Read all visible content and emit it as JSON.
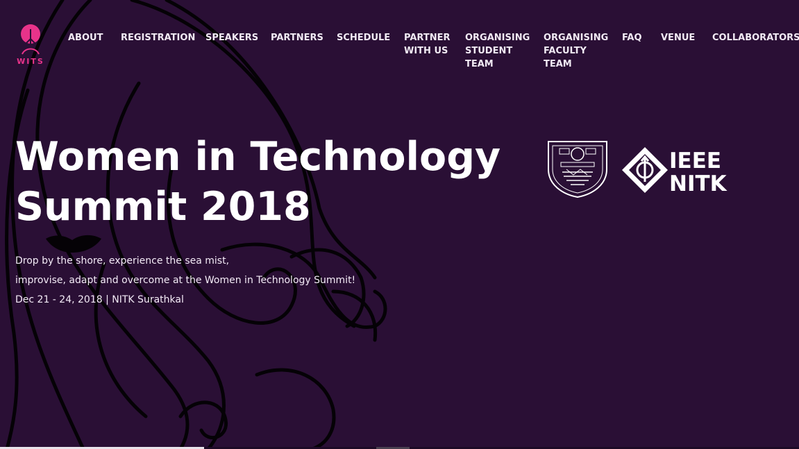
{
  "brand": {
    "logo_text": "WITS",
    "accent_color": "#e8338a",
    "background_color": "#2a0f35"
  },
  "nav": {
    "items": [
      {
        "label": "ABOUT"
      },
      {
        "label": "REGISTRATION"
      },
      {
        "label": "SPEAKERS"
      },
      {
        "label": "PARTNERS"
      },
      {
        "label": "SCHEDULE"
      },
      {
        "label": "PARTNER\nWITH US"
      },
      {
        "label": "ORGANISING\nSTUDENT\nTEAM"
      },
      {
        "label": "ORGANISING\nFACULTY\nTEAM"
      },
      {
        "label": "FAQ"
      },
      {
        "label": "VENUE"
      },
      {
        "label": "COLLABORATORS"
      }
    ]
  },
  "hero": {
    "title": "Women in Technology Summit 2018",
    "line1": "Drop by the shore, experience the sea mist,",
    "line2": "improvise, adapt and overcome at the Women in Technology Summit!",
    "line3": "Dec 21 - 24, 2018 | NITK Surathkal"
  },
  "partner_logos": {
    "nitk_crest_icon": "nitk-crest",
    "ieee_line1": "IEEE",
    "ieee_line2": "NITK"
  }
}
